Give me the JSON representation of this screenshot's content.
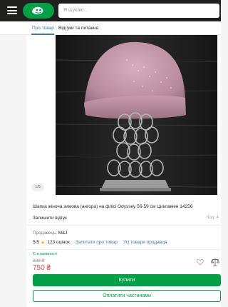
{
  "header": {
    "search_placeholder": "Я шукаю..."
  },
  "tabs": [
    {
      "label": "Про товар"
    },
    {
      "label": "Відгуки та питання"
    }
  ],
  "product": {
    "image_counter": "1/5",
    "title": "Шапка жіноча зимова (ангора) на флісі Odyssey 56-59 см Цикламен 14256",
    "review_link": "Залишити відгук",
    "code": "Код: 4",
    "seller_label": "Продавець:",
    "seller_name": "M&J",
    "rating": "5/5",
    "rating_count": "123 оцінок",
    "ask_link": "Запитати про товар",
    "seller_products_link": "Усі товари продавця",
    "availability": "Є в наявності",
    "old_price": "898 ₴",
    "price": "750 ₴",
    "buy_button": "Купити",
    "credit_button": "Оплатити частинами"
  },
  "colors": {
    "header_bg": "#221f1f",
    "brand_green": "#00a046",
    "link_blue": "#3e77aa",
    "price_red": "#f84147",
    "star": "#ffa900"
  }
}
